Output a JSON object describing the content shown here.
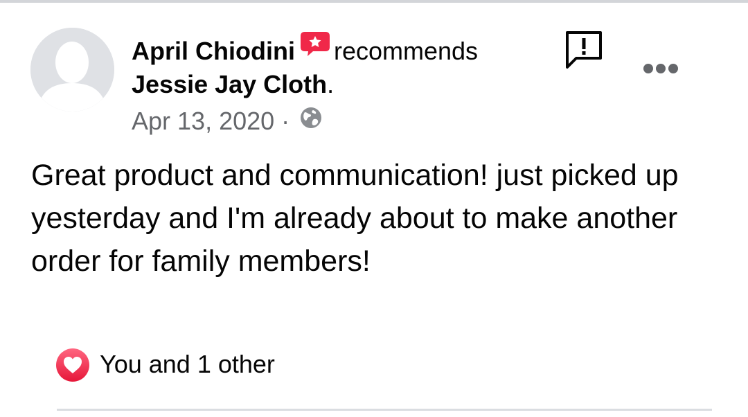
{
  "post": {
    "author": "April Chiodini",
    "action": "recommends",
    "page_name": "Jessie Jay Cloth",
    "page_suffix": ".",
    "date": "Apr 13, 2020",
    "separator": " · ",
    "audience_icon": "globe-icon",
    "text": "Great product and communication! just picked up yesterday and I'm already about to make another order for family members!"
  },
  "reactions": {
    "icon": "heart-icon",
    "summary": "You and 1 other"
  },
  "icons": {
    "recommend_badge": "recommend-star-icon",
    "report": "report-flag-icon",
    "more": "more-options-icon",
    "accent": "#f02849"
  }
}
